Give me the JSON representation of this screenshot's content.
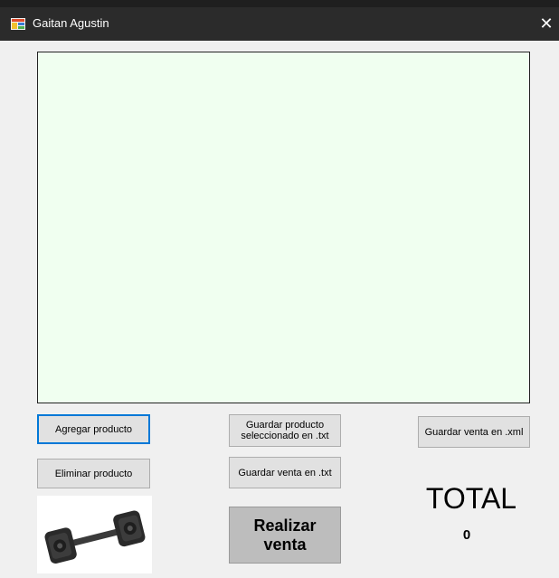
{
  "window": {
    "title": "Gaitan Agustin",
    "close_glyph": "✕",
    "icon": "app-icon"
  },
  "buttons": {
    "agregar": "Agregar producto",
    "eliminar": "Eliminar producto",
    "guardar_seleccionado_line1": "Guardar producto",
    "guardar_seleccionado_line2": "seleccionado en .txt",
    "guardar_venta_txt": "Guardar venta en .txt",
    "guardar_venta_xml": "Guardar venta en .xml",
    "realizar_line1": "Realizar",
    "realizar_line2": "venta"
  },
  "total": {
    "label": "TOTAL",
    "value": "0"
  },
  "image": {
    "subject": "dumbbell-image"
  },
  "colors": {
    "list_background": "#f0fff0",
    "titlebar": "#2b2b2b",
    "focus_border": "#0078d7"
  }
}
